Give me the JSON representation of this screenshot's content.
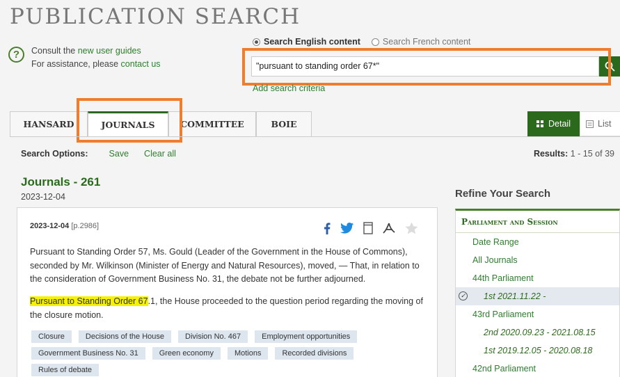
{
  "page": {
    "title": "PUBLICATION SEARCH"
  },
  "help": {
    "line1_prefix": "Consult the ",
    "line1_link": "new user guides",
    "line2_prefix": "For assistance, please ",
    "line2_link": "contact us"
  },
  "search": {
    "lang_english": "Search English content",
    "lang_french": "Search French content",
    "query": "\"pursuant to standing order 67*\"",
    "add_criteria": "Add search criteria"
  },
  "tabs": [
    {
      "label": "HANSARD"
    },
    {
      "label": "JOURNALS"
    },
    {
      "label": "COMMITTEE"
    },
    {
      "label": "BOIE"
    }
  ],
  "view": {
    "detail": "Detail",
    "list": "List"
  },
  "options": {
    "label": "Search Options:",
    "save": "Save",
    "clear": "Clear all"
  },
  "results": {
    "label": "Results:",
    "range": "1 - 15 of 39"
  },
  "result": {
    "heading": "Journals - 261",
    "date": "2023-12-04",
    "card_date": "2023-12-04",
    "card_page": "[p.2986]",
    "para1": "Pursuant to Standing Order 57, Ms. Gould (Leader of the Government in the House of Commons), seconded by Mr. Wilkinson (Minister of Energy and Natural Resources), moved, — That, in relation to the consideration of Government Business No. 31, the debate not be further adjourned.",
    "para2_highlight": "Pursuant to Standing Order 67",
    "para2_rest": ".1, the House proceeded to the question period regarding the moving of the closure motion.",
    "tags": [
      "Closure",
      "Decisions of the House",
      "Division No. 467",
      "Employment opportunities",
      "Government Business No. 31",
      "Green economy",
      "Motions",
      "Recorded divisions",
      "Rules of debate"
    ]
  },
  "refine": {
    "title": "Refine Your Search",
    "facet_title": "Parliament and Session",
    "items": [
      {
        "label": "Date Range"
      },
      {
        "label": "All Journals"
      },
      {
        "label": "44th Parliament"
      },
      {
        "label": "1st 2021.11.22 -"
      },
      {
        "label": "43rd Parliament"
      },
      {
        "label": "2nd 2020.09.23 - 2021.08.15"
      },
      {
        "label": "1st 2019.12.05 - 2020.08.18"
      },
      {
        "label": "42nd Parliament"
      }
    ]
  },
  "colors": {
    "accent": "#2b6a1d",
    "highlight_box": "#ef7d2d",
    "text_highlight": "#f5f100"
  },
  "icons": [
    "help-icon",
    "search-icon",
    "facebook-icon",
    "twitter-icon",
    "bookmark-icon",
    "pdf-icon",
    "star-icon",
    "grid-icon",
    "list-icon",
    "check-circle-icon"
  ]
}
